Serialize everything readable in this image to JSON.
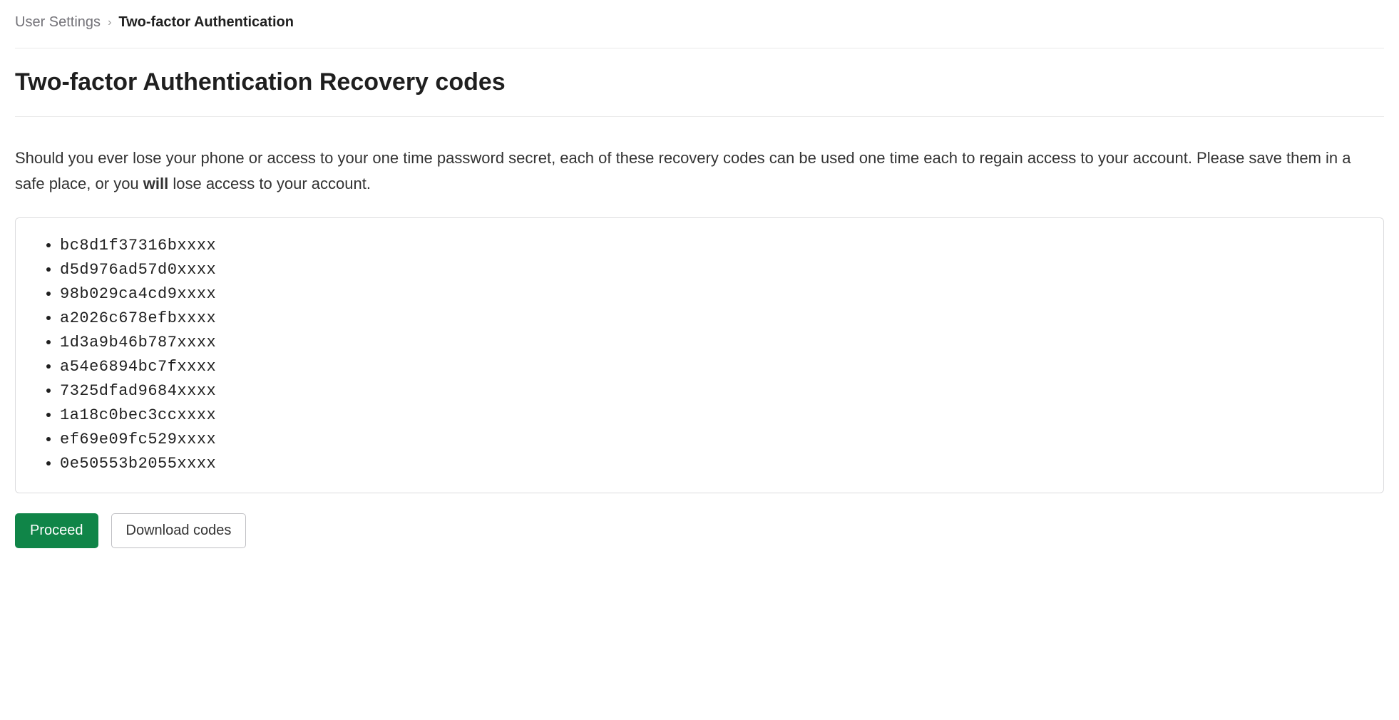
{
  "breadcrumb": {
    "parent": "User Settings",
    "current": "Two-factor Authentication"
  },
  "page": {
    "title": "Two-factor Authentication Recovery codes",
    "description_before": "Should you ever lose your phone or access to your one time password secret, each of these recovery codes can be used one time each to regain access to your account. Please save them in a safe place, or you ",
    "description_strong": "will",
    "description_after": " lose access to your account."
  },
  "recovery_codes": [
    "bc8d1f37316bxxxx",
    "d5d976ad57d0xxxx",
    "98b029ca4cd9xxxx",
    "a2026c678efbxxxx",
    "1d3a9b46b787xxxx",
    "a54e6894bc7fxxxx",
    "7325dfad9684xxxx",
    "1a18c0bec3ccxxxx",
    "ef69e09fc529xxxx",
    "0e50553b2055xxxx"
  ],
  "actions": {
    "proceed": "Proceed",
    "download": "Download codes"
  }
}
